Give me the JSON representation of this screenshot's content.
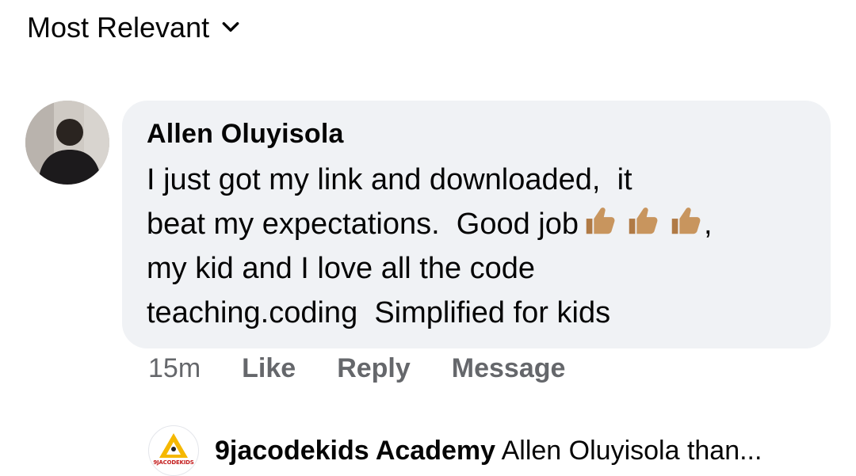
{
  "sort": {
    "label": "Most Relevant",
    "icon": "chevron-down-icon"
  },
  "comment": {
    "author": "Allen Oluyisola",
    "text_before_emoji": "I just got my link and downloaded,  it\nbeat my expectations.  Good job",
    "emoji": [
      "thumbs-up-icon",
      "thumbs-up-icon",
      "thumbs-up-icon"
    ],
    "text_after_emoji": ",\nmy kid and I love all the code\nteaching.coding  Simplified for kids",
    "time": "15m",
    "actions": {
      "like": "Like",
      "reply": "Reply",
      "message": "Message"
    }
  },
  "reply": {
    "avatar_text": "9JACODEKIDS",
    "author": "9jacodekids Academy",
    "snippet": "Allen Oluyisola than..."
  },
  "colors": {
    "bubble": "#f0f2f5",
    "secondary_text": "#65676b",
    "thumb_skin": "#c8955e",
    "logo_yellow": "#f5b800"
  }
}
